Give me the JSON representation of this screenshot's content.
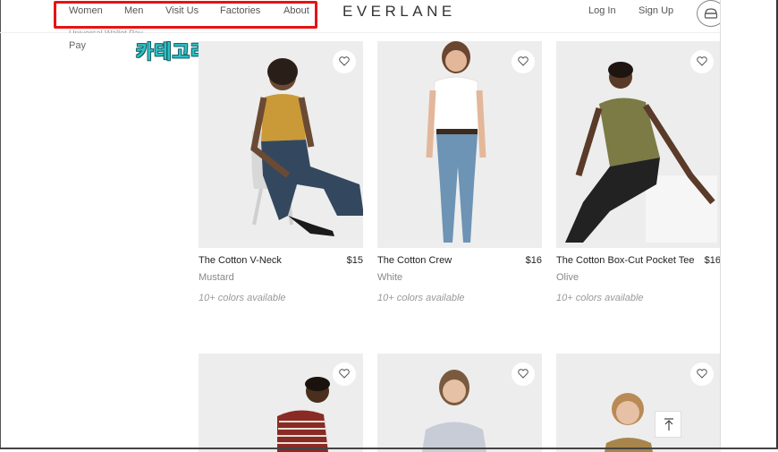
{
  "nav": {
    "items": [
      "Women",
      "Men",
      "Visit Us",
      "Factories",
      "About"
    ],
    "brand": "EVERLANE",
    "login": "Log In",
    "signup": "Sign Up"
  },
  "sidebar": {
    "partial_text": "Universal Wallet Pay",
    "pay": "Pay"
  },
  "annotation": "카테고리 선택하기",
  "colors": {
    "annotation": "#2bc1c9",
    "highlight_box": "#e41414"
  },
  "products": [
    {
      "title": "The Cotton V-Neck",
      "price": "$15",
      "color": "Mustard",
      "availability": "10+ colors available"
    },
    {
      "title": "The Cotton Crew",
      "price": "$16",
      "color": "White",
      "availability": "10+ colors available"
    },
    {
      "title": "The Cotton Box-Cut Pocket Tee",
      "price": "$16",
      "color": "Olive",
      "availability": "10+ colors available"
    }
  ],
  "icons": {
    "heart": "heart-icon",
    "cart": "cart-icon",
    "scroll_top": "arrow-up-icon"
  }
}
